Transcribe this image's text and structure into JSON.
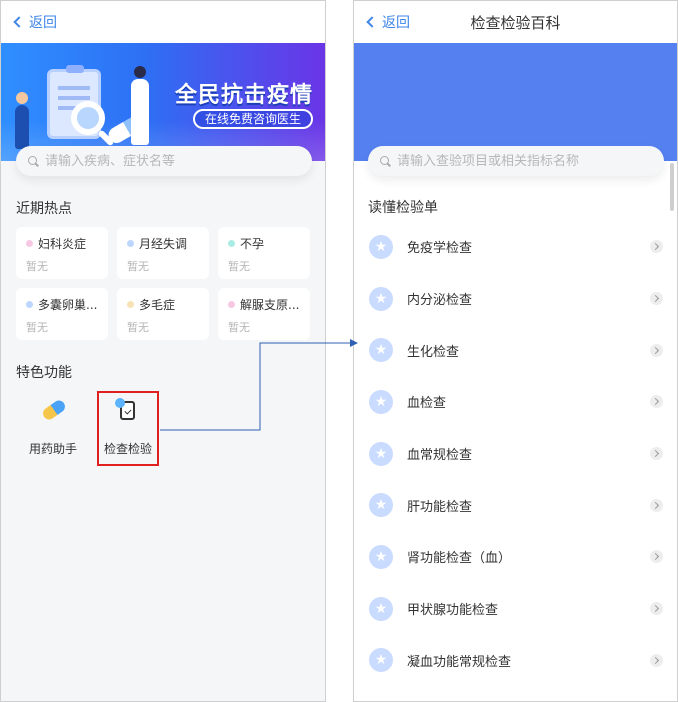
{
  "left": {
    "back_label": "返回",
    "banner": {
      "title": "全民抗击疫情",
      "subtitle": "在线免费咨询医生"
    },
    "search_placeholder": "请输入疾病、症状名等",
    "hot_title": "近期热点",
    "hot_items": [
      {
        "name": "妇科炎症",
        "sub": "暂无",
        "dot_color": "#f7c8e4"
      },
      {
        "name": "月经失调",
        "sub": "暂无",
        "dot_color": "#bcd6ff"
      },
      {
        "name": "不孕",
        "sub": "暂无",
        "dot_color": "#a8ece4"
      },
      {
        "name": "多囊卵巢...",
        "sub": "暂无",
        "dot_color": "#bcd6ff"
      },
      {
        "name": "多毛症",
        "sub": "暂无",
        "dot_color": "#f6e2b4"
      },
      {
        "name": "解脲支原...",
        "sub": "暂无",
        "dot_color": "#f7c8e4"
      }
    ],
    "features_title": "特色功能",
    "features": [
      {
        "label": "用药助手",
        "icon": "capsule-icon"
      },
      {
        "label": "检查检验",
        "icon": "clipboard-check-icon"
      }
    ]
  },
  "right": {
    "back_label": "返回",
    "title": "检查检验百科",
    "search_placeholder": "请输入查验项目或相关指标名称",
    "section_title": "读懂检验单",
    "items": [
      "免疫学检查",
      "内分泌检查",
      "生化检查",
      "血检查",
      "血常规检查",
      "肝功能检查",
      "肾功能检查（血）",
      "甲状腺功能检查",
      "凝血功能常规检查"
    ]
  },
  "colors": {
    "accent": "#3f86e8",
    "highlight": "#e02020",
    "header_blue": "#5580f0",
    "connector": "#2f5fb3"
  }
}
